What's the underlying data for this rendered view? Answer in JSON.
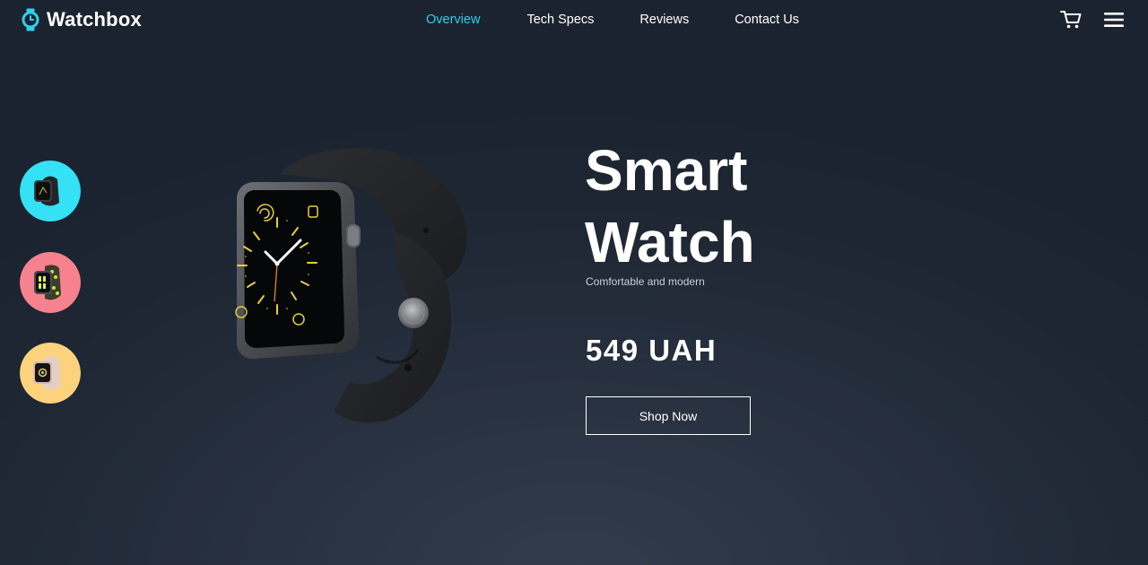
{
  "brand": {
    "name": "Watchbox",
    "logo_icon": "watch-icon",
    "accent": "#2fd0ea"
  },
  "nav": {
    "links": [
      {
        "label": "Overview",
        "active": true
      },
      {
        "label": "Tech Specs",
        "active": false
      },
      {
        "label": "Reviews",
        "active": false
      },
      {
        "label": "Contact Us",
        "active": false
      }
    ],
    "cart_icon": "cart-icon",
    "menu_icon": "hamburger-menu-icon"
  },
  "variants": [
    {
      "name": "black-sport",
      "bg_color": "#35e1f5"
    },
    {
      "name": "lime-sport",
      "bg_color": "#f7828f"
    },
    {
      "name": "pink-sand",
      "bg_color": "#fcd27d"
    }
  ],
  "hero": {
    "title_line1": "Smart",
    "title_line2": "Watch",
    "subtitle": "Comfortable and modern",
    "price": "549 UAH",
    "cta_label": "Shop Now"
  }
}
